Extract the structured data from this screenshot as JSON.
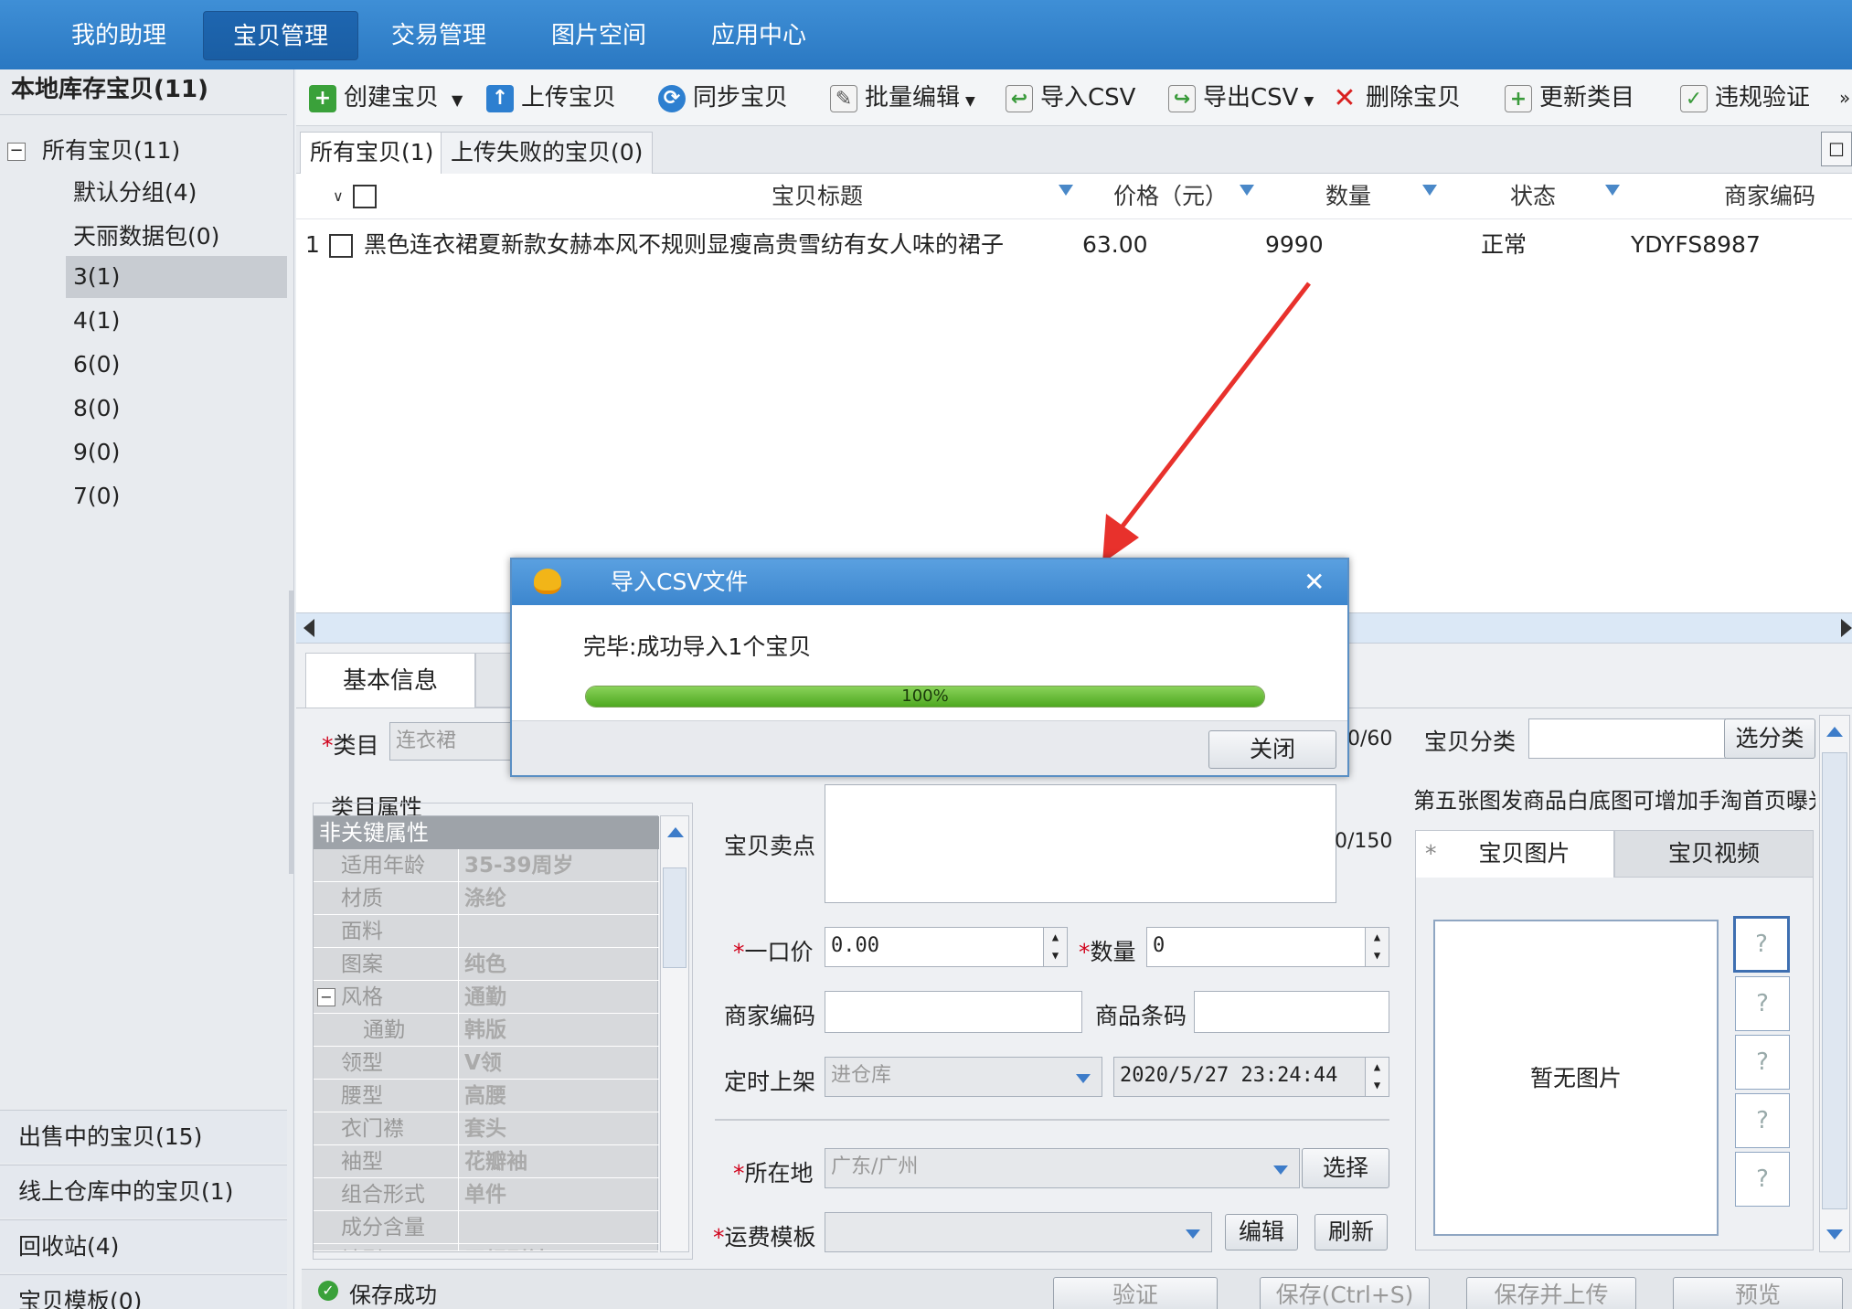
{
  "topnav": [
    "我的助理",
    "宝贝管理",
    "交易管理",
    "图片空间",
    "应用中心"
  ],
  "left": {
    "header": "本地库存宝贝(11)",
    "root": "所有宝贝(11)",
    "groups": [
      "默认分组(4)",
      "天丽数据包(0)",
      "3(1)",
      "4(1)",
      "6(0)",
      "8(0)",
      "9(0)",
      "7(0)"
    ],
    "bottom": [
      "出售中的宝贝(15)",
      "线上仓库中的宝贝(1)",
      "回收站(4)",
      "宝贝模板(0)"
    ]
  },
  "toolbar": [
    "创建宝贝",
    "上传宝贝",
    "同步宝贝",
    "批量编辑",
    "导入CSV",
    "导出CSV",
    "删除宝贝",
    "更新类目",
    "违规验证"
  ],
  "tabs": [
    "所有宝贝(1)",
    "上传失败的宝贝(0)"
  ],
  "grid": {
    "headers": [
      "宝贝标题",
      "价格（元）",
      "数量",
      "状态",
      "商家编码"
    ],
    "row": {
      "index": "1",
      "title": "黑色连衣裙夏新款女赫本风不规则显瘦高贵雪纺有女人味的裙子",
      "price": "63.00",
      "qty": "9990",
      "status": "正常",
      "code": "YDYFS8987"
    }
  },
  "form": {
    "tab": "基本信息",
    "category_label": "类目",
    "category_value": "连衣裙",
    "counter1": "0/60",
    "baobei_category_label": "宝贝分类",
    "select_category_btn": "选分类",
    "props_title": "类目属性",
    "props_section": "非关键属性",
    "props": [
      {
        "k": "适用年龄",
        "v": "35-39周岁"
      },
      {
        "k": "材质",
        "v": "涤纶"
      },
      {
        "k": "面料",
        "v": ""
      },
      {
        "k": "图案",
        "v": "纯色"
      },
      {
        "k": "风格",
        "v": "通勤"
      },
      {
        "k": "通勤",
        "v": "韩版"
      },
      {
        "k": "领型",
        "v": "V领"
      },
      {
        "k": "腰型",
        "v": "高腰"
      },
      {
        "k": "衣门襟",
        "v": "套头"
      },
      {
        "k": "袖型",
        "v": "花瓣袖"
      },
      {
        "k": "组合形式",
        "v": "单件"
      },
      {
        "k": "成分含量",
        "v": ""
      },
      {
        "k": "袖型",
        "v": "无规则袖"
      }
    ],
    "selling_point_label": "宝贝卖点",
    "counter2": "0/150",
    "hint": "第五张图发商品白底图可增加手淘首页曝光",
    "price_label": "一口价",
    "price_value": "0.00",
    "qty_label": "数量",
    "qty_value": "0",
    "merchant_code_label": "商家编码",
    "barcode_label": "商品条码",
    "schedule_label": "定时上架",
    "schedule_value": "进仓库",
    "datetime": "2020/5/27 23:24:44",
    "location_label": "所在地",
    "location_value": "广东/广州",
    "choose_btn": "选择",
    "shipping_label": "运费模板",
    "edit_btn": "编辑",
    "refresh_btn": "刷新",
    "image_tabs": [
      "宝贝图片",
      "宝贝视频"
    ],
    "no_image": "暂无图片",
    "thumb_mark": "?"
  },
  "statusbar": {
    "message": "保存成功",
    "buttons": [
      "验证",
      "保存(Ctrl+S)",
      "保存并上传",
      "预览"
    ]
  },
  "dialog": {
    "title": "导入CSV文件",
    "message": "完毕:成功导入1个宝贝",
    "progress_label": "100%",
    "progress": 1.0,
    "close_btn": "关闭"
  },
  "colors": {
    "nav": "#2a78c2",
    "progress": "#5cbf2a",
    "arrow": "#e8312c"
  }
}
